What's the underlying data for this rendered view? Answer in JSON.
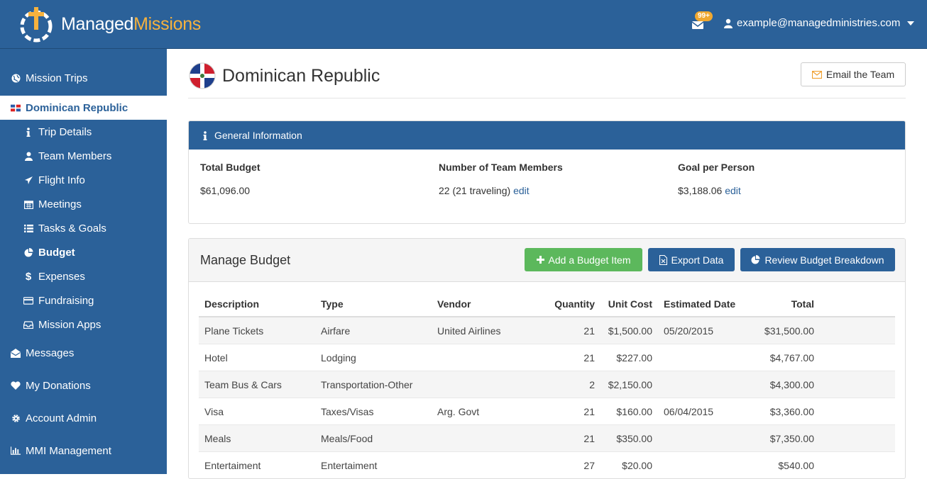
{
  "brand": {
    "name_part1": "Managed",
    "name_part2": "Missions"
  },
  "header": {
    "notification_count": "99+",
    "user_email": "example@managedministries.com"
  },
  "sidebar": {
    "items": [
      {
        "label": "Mission Trips",
        "icon": "globe-icon"
      },
      {
        "label": "Dominican Republic",
        "icon": "flag-icon"
      },
      {
        "label": "Trip Details",
        "icon": "info-icon"
      },
      {
        "label": "Team Members",
        "icon": "user-icon"
      },
      {
        "label": "Flight Info",
        "icon": "plane-icon"
      },
      {
        "label": "Meetings",
        "icon": "calendar-icon"
      },
      {
        "label": "Tasks & Goals",
        "icon": "list-icon"
      },
      {
        "label": "Budget",
        "icon": "pie-chart-icon"
      },
      {
        "label": "Expenses",
        "icon": "dollar-icon"
      },
      {
        "label": "Fundraising",
        "icon": "credit-card-icon"
      },
      {
        "label": "Mission Apps",
        "icon": "inbox-icon"
      },
      {
        "label": "Messages",
        "icon": "envelope-open-icon"
      },
      {
        "label": "My Donations",
        "icon": "heart-icon"
      },
      {
        "label": "Account Admin",
        "icon": "gear-icon"
      },
      {
        "label": "MMI Management",
        "icon": "bar-chart-icon"
      }
    ]
  },
  "page": {
    "title": "Dominican Republic",
    "email_team_label": "Email the Team"
  },
  "general_info": {
    "heading": "General Information",
    "total_budget_label": "Total Budget",
    "total_budget_value": "$61,096.00",
    "team_members_label": "Number of Team Members",
    "team_members_value": "22 (21 traveling)",
    "goal_label": "Goal per Person",
    "goal_value": "$3,188.06",
    "edit_label": "edit"
  },
  "budget": {
    "heading": "Manage Budget",
    "add_label": "Add a Budget Item",
    "export_label": "Export Data",
    "review_label": "Review Budget Breakdown",
    "columns": [
      "Description",
      "Type",
      "Vendor",
      "Quantity",
      "Unit Cost",
      "Estimated Date",
      "Total"
    ],
    "rows": [
      [
        "Plane Tickets",
        "Airfare",
        "United Airlines",
        "21",
        "$1,500.00",
        "05/20/2015",
        "$31,500.00"
      ],
      [
        "Hotel",
        "Lodging",
        "",
        "21",
        "$227.00",
        "",
        "$4,767.00"
      ],
      [
        "Team Bus & Cars",
        "Transportation-Other",
        "",
        "2",
        "$2,150.00",
        "",
        "$4,300.00"
      ],
      [
        "Visa",
        "Taxes/Visas",
        "Arg. Govt",
        "21",
        "$160.00",
        "06/04/2015",
        "$3,360.00"
      ],
      [
        "Meals",
        "Meals/Food",
        "",
        "21",
        "$350.00",
        "",
        "$7,350.00"
      ],
      [
        "Entertaiment",
        "Entertaiment",
        "",
        "27",
        "$20.00",
        "",
        "$540.00"
      ]
    ]
  },
  "colors": {
    "primary": "#2b6199",
    "accent": "#f6b23e",
    "success": "#5cb85c"
  }
}
